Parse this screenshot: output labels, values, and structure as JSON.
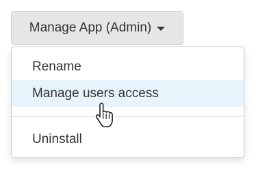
{
  "dropdown": {
    "toggle_label": "Manage App (Admin)",
    "toggle_icon": "caret-down-icon",
    "items": [
      {
        "label": "Rename"
      },
      {
        "label": "Manage users access",
        "highlighted": true
      },
      {
        "label": "Uninstall"
      }
    ]
  },
  "colors": {
    "toggle_background": "#e6e6e6",
    "highlight_background": "#e8f4fb",
    "text": "#333333"
  },
  "cursor": {
    "icon": "hand-pointer-icon"
  }
}
